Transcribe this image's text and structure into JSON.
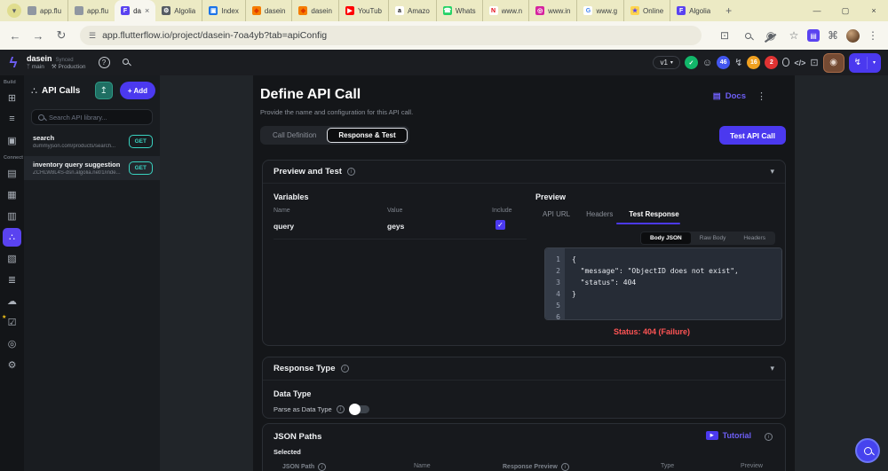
{
  "colors": {
    "accent": "#4b39ef",
    "teal": "#39d2c0",
    "error": "#ff5454",
    "selected_eye": "#744a33"
  },
  "icons": {
    "tab_chevron": "▾",
    "close": "×",
    "new_tab": "+",
    "minimize": "—",
    "maximize": "▢",
    "back": "←",
    "forward": "→",
    "reload": "↻",
    "tune": "☰",
    "cast": "⊡",
    "star": "☆",
    "eye": "◉",
    "puzzle": "⌘",
    "menu": "⋮",
    "logo": "ϟ",
    "help": "?",
    "branch": "ᛉ",
    "wrench": "⚒",
    "check": "✓",
    "assistant": "☺",
    "flash": "↯",
    "code": "</>",
    "open_new": "⊡",
    "chevron_down": "▾",
    "upload": "↥",
    "info": "i",
    "kebab": "⋮",
    "docs": "▤",
    "play": "▶",
    "api": "∴",
    "rail": [
      "⊞",
      "≡",
      "▣",
      "▤",
      "▦",
      "▥",
      "∴",
      "▧",
      "≣",
      "☁",
      "☑",
      "◎",
      "⚙"
    ]
  },
  "browser": {
    "tabs": [
      {
        "label": "app.flu",
        "fav": {
          "bg": "#9097a1",
          "glyph": "",
          "fg": "#ffffff"
        }
      },
      {
        "label": "app.flu",
        "fav": {
          "bg": "#9097a1",
          "glyph": "",
          "fg": "#ffffff"
        }
      },
      {
        "label": "da",
        "active": true,
        "fav": {
          "bg": "#5a43f0",
          "glyph": "F",
          "fg": "#ffffff"
        }
      },
      {
        "label": "Algolia",
        "fav": {
          "bg": "#555b63",
          "glyph": "⚙",
          "fg": "#ffffff"
        }
      },
      {
        "label": "Index",
        "fav": {
          "bg": "#1a73e8",
          "glyph": "▣",
          "fg": "#ffffff"
        }
      },
      {
        "label": "dasein",
        "fav": {
          "bg": "#f57c00",
          "glyph": "◆",
          "fg": "#e03a00"
        }
      },
      {
        "label": "dasein",
        "fav": {
          "bg": "#f57c00",
          "glyph": "◆",
          "fg": "#e03a00"
        }
      },
      {
        "label": "YouTub",
        "fav": {
          "bg": "#ff0000",
          "glyph": "▶",
          "fg": "#ffffff"
        }
      },
      {
        "label": "Amazo",
        "fav": {
          "bg": "#ffffff",
          "glyph": "a",
          "fg": "#111111"
        }
      },
      {
        "label": "Whats",
        "fav": {
          "bg": "#25d366",
          "glyph": "☎",
          "fg": "#ffffff"
        }
      },
      {
        "label": "www.n",
        "fav": {
          "bg": "#ffffff",
          "glyph": "N",
          "fg": "#e50914"
        }
      },
      {
        "label": "www.in",
        "fav": {
          "bg": "#d6249f",
          "glyph": "◎",
          "fg": "#ffffff"
        }
      },
      {
        "label": "www.g",
        "fav": {
          "bg": "#ffffff",
          "glyph": "G",
          "fg": "#4285f4"
        }
      },
      {
        "label": "Online",
        "fav": {
          "bg": "#ffd54f",
          "glyph": "★",
          "fg": "#5a43f0"
        }
      },
      {
        "label": "Algolia",
        "fav": {
          "bg": "#5a43f0",
          "glyph": "F",
          "fg": "#ffffff"
        }
      }
    ],
    "url": "app.flutterflow.io/project/dasein-7oa4yb?tab=apiConfig"
  },
  "app_header": {
    "project_name": "dasein",
    "sync_status": "Synced",
    "branch": "main",
    "environment": "Production",
    "version": "v1",
    "badge_blue": "46",
    "badge_orange": "16",
    "badge_red": "2"
  },
  "rail": {
    "section1": "Build",
    "section2": "Connect"
  },
  "api_panel": {
    "title": "API Calls",
    "add_label": "+ Add",
    "search_placeholder": "Search API library...",
    "items": [
      {
        "name": "search",
        "url": "dummyjson.com/products/search...",
        "method": "GET"
      },
      {
        "name": "inventory query suggestion",
        "url": "ZCHLW8L4S-dsn.algolia.net/1/inde...",
        "method": "GET"
      }
    ]
  },
  "main": {
    "title": "Define API Call",
    "subtitle": "Provide the name and configuration for this API call.",
    "docs_label": "Docs",
    "tabs": [
      {
        "label": "Call Definition"
      },
      {
        "label": "Response & Test"
      }
    ],
    "test_button": "Test API Call",
    "preview_test": {
      "title": "Preview and Test",
      "variables_title": "Variables",
      "columns": {
        "name": "Name",
        "value": "Value",
        "include": "Include"
      },
      "row": {
        "name": "query",
        "value": "geys",
        "include": "✓"
      },
      "preview_title": "Preview",
      "preview_tabs": [
        {
          "label": "API URL"
        },
        {
          "label": "Headers"
        },
        {
          "label": "Test Response"
        }
      ],
      "body_tabs": [
        {
          "label": "Body JSON"
        },
        {
          "label": "Raw Body"
        },
        {
          "label": "Headers"
        }
      ],
      "line_numbers": "1\n2\n3\n4\n5\n6",
      "code": "{\n  \"message\": \"ObjectID does not exist\",\n  \"status\": 404\n}",
      "status_label": "Status:",
      "status_value": " 404 (Failure)"
    },
    "response_type": {
      "title": "Response Type",
      "data_type_title": "Data Type",
      "toggle_label": "Parse as Data Type"
    },
    "json_paths": {
      "title": "JSON Paths",
      "tutorial_label": "Tutorial",
      "selected_label": "Selected",
      "columns": {
        "path": "JSON Path",
        "name": "Name",
        "preview": "Response Preview",
        "type": "Type",
        "preview2": "Preview"
      }
    }
  }
}
